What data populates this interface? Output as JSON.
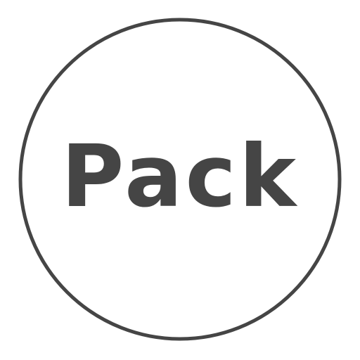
{
  "icon": {
    "label": "Pack",
    "stroke_color": "#454545",
    "text_color": "#454545",
    "background_color": "#ffffff",
    "shape": "circle-outline"
  }
}
